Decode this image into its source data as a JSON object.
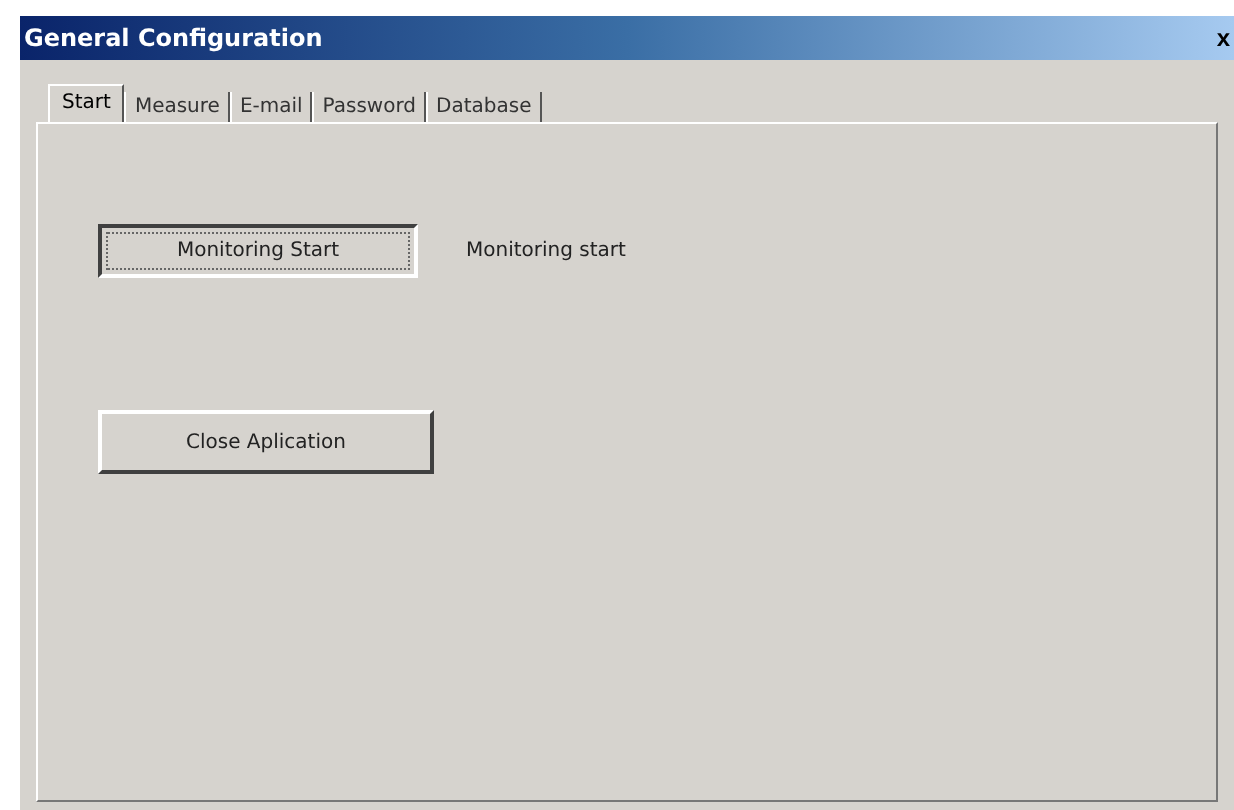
{
  "window": {
    "title": "General Configuration",
    "close": "x"
  },
  "tabs": [
    {
      "label": "Start",
      "selected": true
    },
    {
      "label": "Measure",
      "selected": false
    },
    {
      "label": "E-mail",
      "selected": false
    },
    {
      "label": "Password",
      "selected": false
    },
    {
      "label": "Database",
      "selected": false
    }
  ],
  "monitoring_button": {
    "label": "Monitoring Start",
    "pressed": true
  },
  "monitoring_status": "Monitoring start",
  "close_button": {
    "label": "Close Aplication",
    "pressed": false
  }
}
